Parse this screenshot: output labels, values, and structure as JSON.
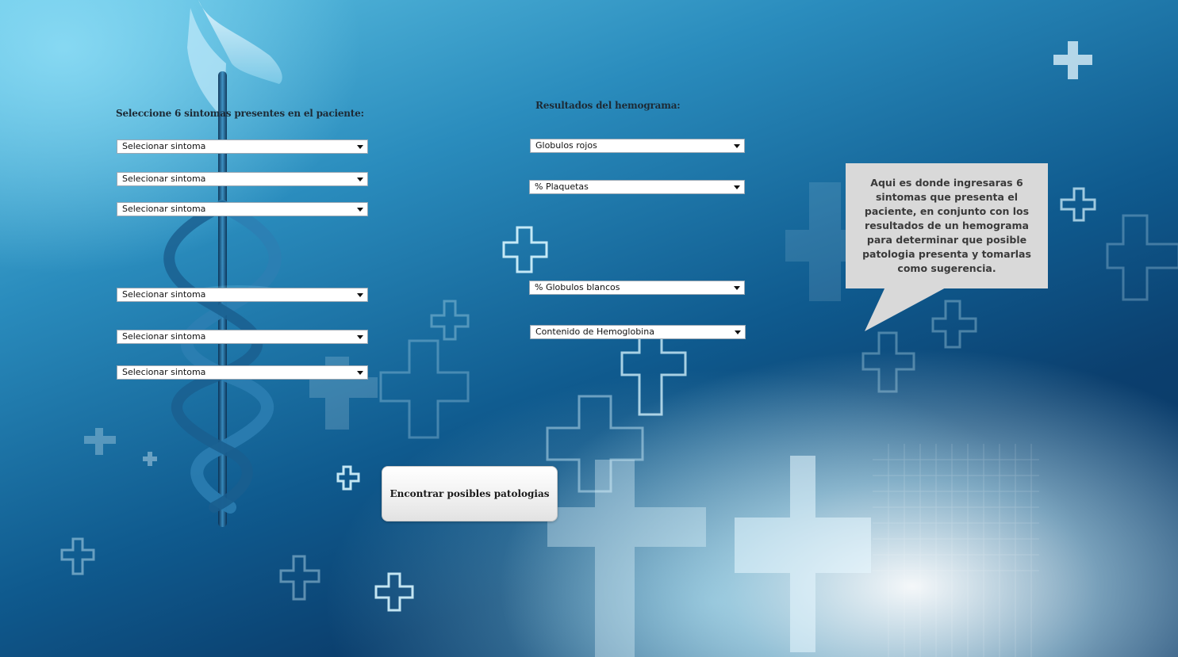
{
  "symptoms": {
    "label": "Seleccione 6 sintomas presentes en el paciente:",
    "selects": [
      {
        "value": "Selecionar sintoma"
      },
      {
        "value": "Selecionar sintoma"
      },
      {
        "value": "Selecionar sintoma"
      },
      {
        "value": "Selecionar sintoma"
      },
      {
        "value": "Selecionar sintoma"
      },
      {
        "value": "Selecionar sintoma"
      }
    ]
  },
  "hemogram": {
    "label": "Resultados del hemograma:",
    "selects": [
      {
        "value": "Globulos rojos"
      },
      {
        "value": "% Plaquetas"
      },
      {
        "value": "% Globulos blancos"
      },
      {
        "value": "Contenido de Hemoglobina"
      }
    ]
  },
  "info_bubble": {
    "text": "Aqui es donde ingresaras 6 sintomas que presenta el paciente, en conjunto con los resultados de un hemograma para determinar que posible patologia presenta y tomarlas como sugerencia."
  },
  "action": {
    "button_label": "Encontrar posibles patologias"
  },
  "colors": {
    "background_top": "#5fc3e4",
    "background_bottom": "#0a3462",
    "bubble": "#d9d9d9"
  }
}
